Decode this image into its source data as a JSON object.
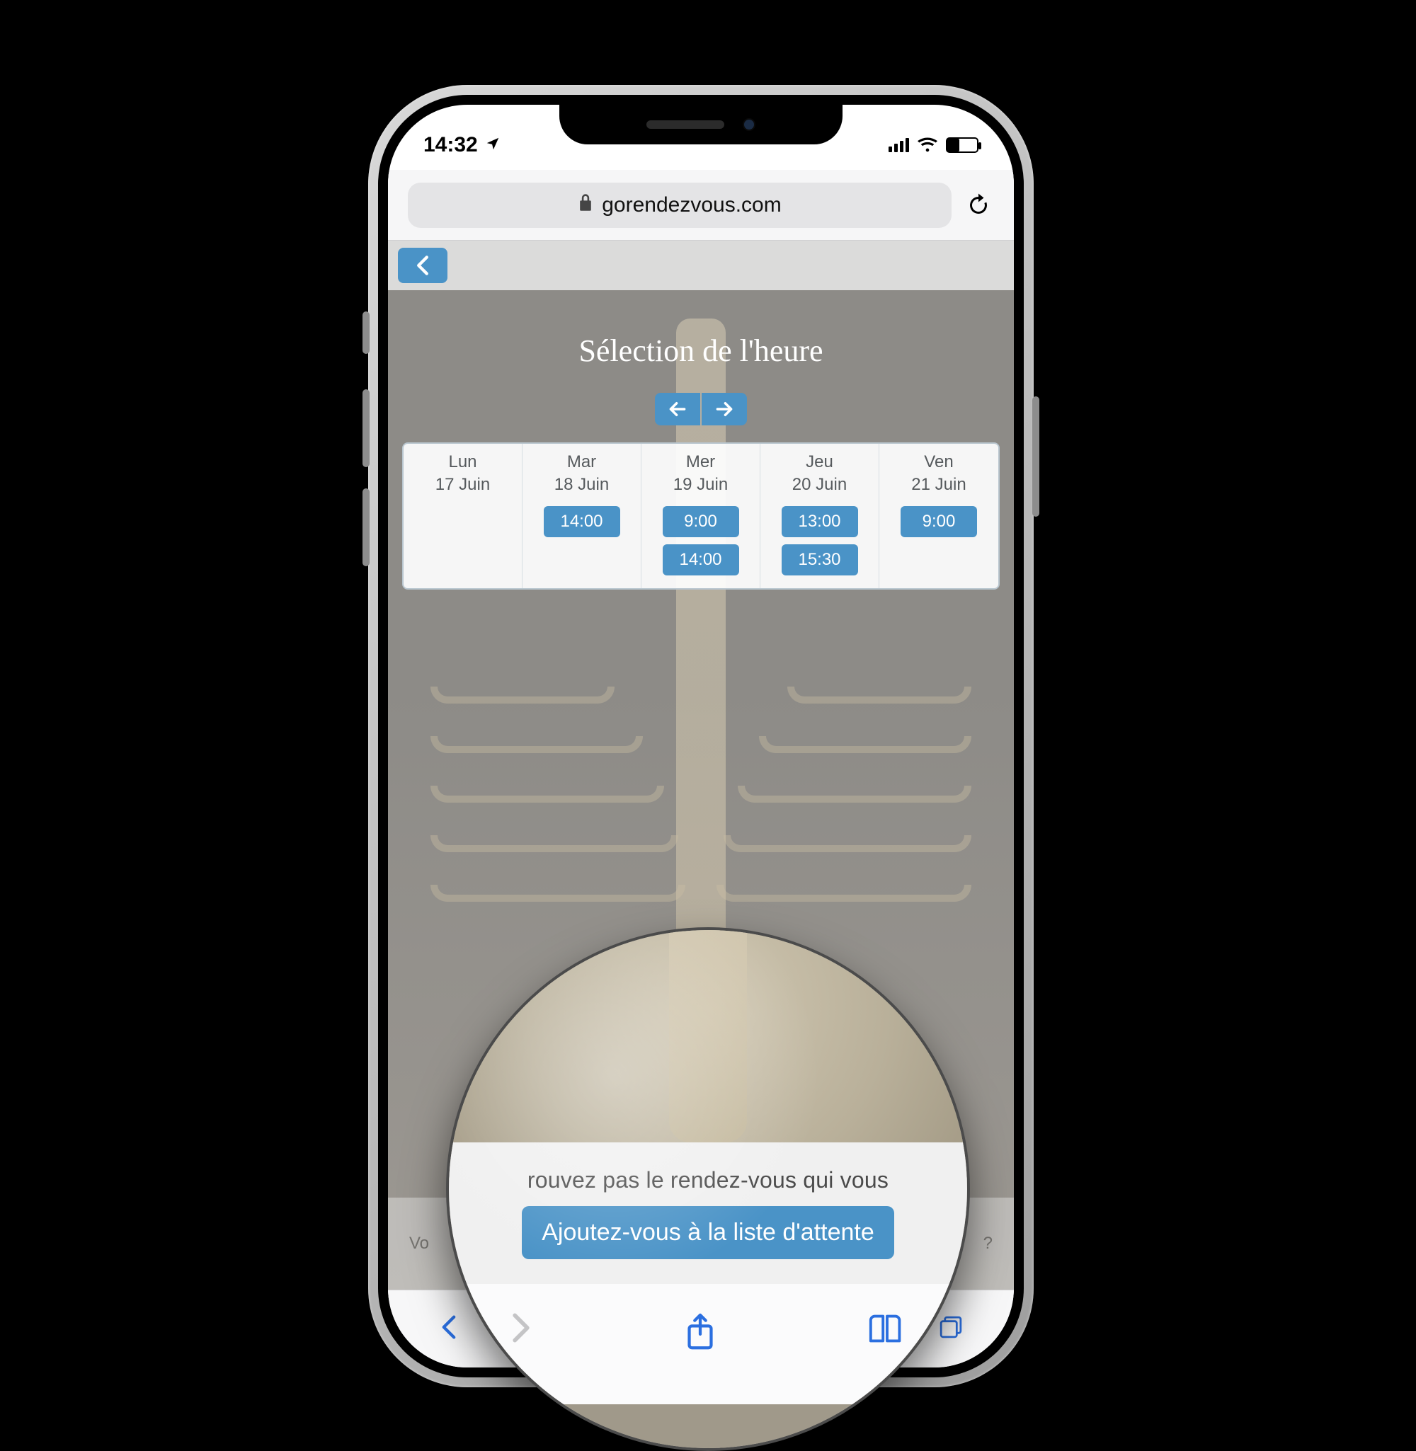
{
  "status": {
    "time": "14:32",
    "location_icon": "location-arrow"
  },
  "browser": {
    "domain": "gorendezvous.com",
    "secure": true
  },
  "page": {
    "title": "Sélection de l'heure",
    "schedule": {
      "columns": [
        {
          "dow": "Lun",
          "date": "17 Juin",
          "slots": []
        },
        {
          "dow": "Mar",
          "date": "18 Juin",
          "slots": [
            "14:00"
          ]
        },
        {
          "dow": "Mer",
          "date": "19 Juin",
          "slots": [
            "9:00",
            "14:00"
          ]
        },
        {
          "dow": "Jeu",
          "date": "20 Juin",
          "slots": [
            "13:00",
            "15:30"
          ]
        },
        {
          "dow": "Ven",
          "date": "21 Juin",
          "slots": [
            "9:00"
          ]
        }
      ]
    },
    "waitlist": {
      "prompt_partial": "rouvez pas le rendez-vous qui vous",
      "button": "Ajoutez-vous à la liste d'attente",
      "faint_left": "Vo",
      "faint_right": "?"
    }
  }
}
